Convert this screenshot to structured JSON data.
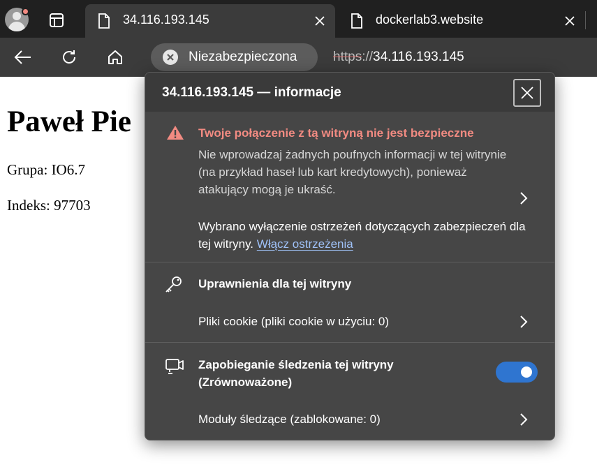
{
  "browser": {
    "tabs": [
      {
        "title": "34.116.193.145",
        "active": true,
        "icon": "page-icon"
      },
      {
        "title": "dockerlab3.website",
        "active": false,
        "icon": "page-icon"
      }
    ],
    "toolbar": {
      "security_chip": "Niezabezpieczona",
      "url_scheme": "https",
      "url_separator": "://",
      "url_host": "34.116.193.145"
    }
  },
  "page": {
    "heading": "Paweł Pie",
    "group": "Grupa: IO6.7",
    "index": "Indeks: 97703"
  },
  "popup": {
    "title": "34.116.193.145 — informacje",
    "warning": {
      "title": "Twoje połączenie z tą witryną nie jest bezpieczne",
      "text": "Nie wprowadzaj żadnych poufnych informacji w tej witrynie (na przykład haseł lub kart kredytowych), ponieważ atakujący mogą je ukraść.",
      "disabled_text": "Wybrano wyłączenie ostrzeżeń dotyczących zabezpieczeń dla tej witryny.",
      "enable_link": "Włącz ostrzeżenia"
    },
    "permissions": {
      "title": "Uprawnienia dla tej witryny",
      "cookies": "Pliki cookie (pliki cookie w użyciu: 0)"
    },
    "tracking": {
      "title_line1": "Zapobieganie śledzenia tej witryny",
      "title_line2": "(Zrównoważone)",
      "toggle_on": true,
      "trackers": "Moduły śledzące (zablokowane: 0)"
    }
  },
  "colors": {
    "warning": "#f28b82",
    "link": "#9fc1f7",
    "toggle": "#2f75d0"
  }
}
